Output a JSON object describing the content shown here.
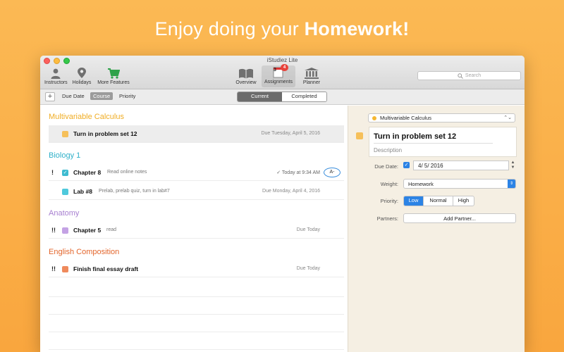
{
  "headline": {
    "prefix": "Enjoy doing your ",
    "bold": "Homework!"
  },
  "window": {
    "title": "iStudiez Lite"
  },
  "toolbar": {
    "items": [
      {
        "label": "Instructors",
        "icon": "person-icon"
      },
      {
        "label": "Holidays",
        "icon": "pin-icon"
      },
      {
        "label": "More Features",
        "icon": "cart-icon"
      },
      {
        "label": "Overview",
        "icon": "book-icon"
      },
      {
        "label": "Assignments",
        "icon": "assignments-icon",
        "badge": "4",
        "calendar_number": "3"
      },
      {
        "label": "Planner",
        "icon": "building-icon"
      }
    ],
    "search_placeholder": "Search"
  },
  "subbar": {
    "sort": [
      "Due Date",
      "Course",
      "Priority"
    ],
    "sort_selected": "Course",
    "tabs": [
      "Current",
      "Completed"
    ],
    "tab_selected": "Current"
  },
  "courses": [
    {
      "name": "Multivariable Calculus",
      "color": "#f5b731",
      "assignments": [
        {
          "priority": "",
          "title": "Turn in problem set 12",
          "note": "",
          "due": "Due Tuesday, April 5, 2016",
          "color": "#f6c05a",
          "checked": false,
          "selected": true
        }
      ]
    },
    {
      "name": "Biology 1",
      "color": "#3ebbd0",
      "assignments": [
        {
          "priority": "!",
          "title": "Chapter 8",
          "note": "Read online notes",
          "due": "✓ Today at 9:34 AM",
          "color": "#3ebbd0",
          "checked": true,
          "grade": "A-"
        },
        {
          "priority": "",
          "title": "Lab #8",
          "note": "Prelab, prelab quiz, turn in lab#7",
          "due": "Due Monday, April 4, 2016",
          "color": "#4fc9dc",
          "checked": false
        }
      ]
    },
    {
      "name": "Anatomy",
      "color": "#b28ad6",
      "assignments": [
        {
          "priority": "!!",
          "title": "Chapter 5",
          "note": "read",
          "due": "Due Today",
          "color": "#c4a2e4",
          "checked": false
        }
      ]
    },
    {
      "name": "English Composition",
      "color": "#e8662d",
      "assignments": [
        {
          "priority": "!!",
          "title": "Finish final essay draft",
          "note": "",
          "due": "Due Today",
          "color": "#ef8a5c",
          "checked": false
        }
      ]
    }
  ],
  "detail": {
    "course": "Multivariable Calculus",
    "course_color": "#f5b731",
    "title": "Turn in problem set 12",
    "description_placeholder": "Description",
    "due_date_label": "Due Date:",
    "due_date_value": "4/  5/ 2016",
    "weight_label": "Weight:",
    "weight_value": "Homework",
    "priority_label": "Priority:",
    "priority_options": [
      "Low",
      "Normal",
      "High"
    ],
    "priority_selected": "Low",
    "partners_label": "Partners:",
    "add_partner": "Add Partner..."
  }
}
